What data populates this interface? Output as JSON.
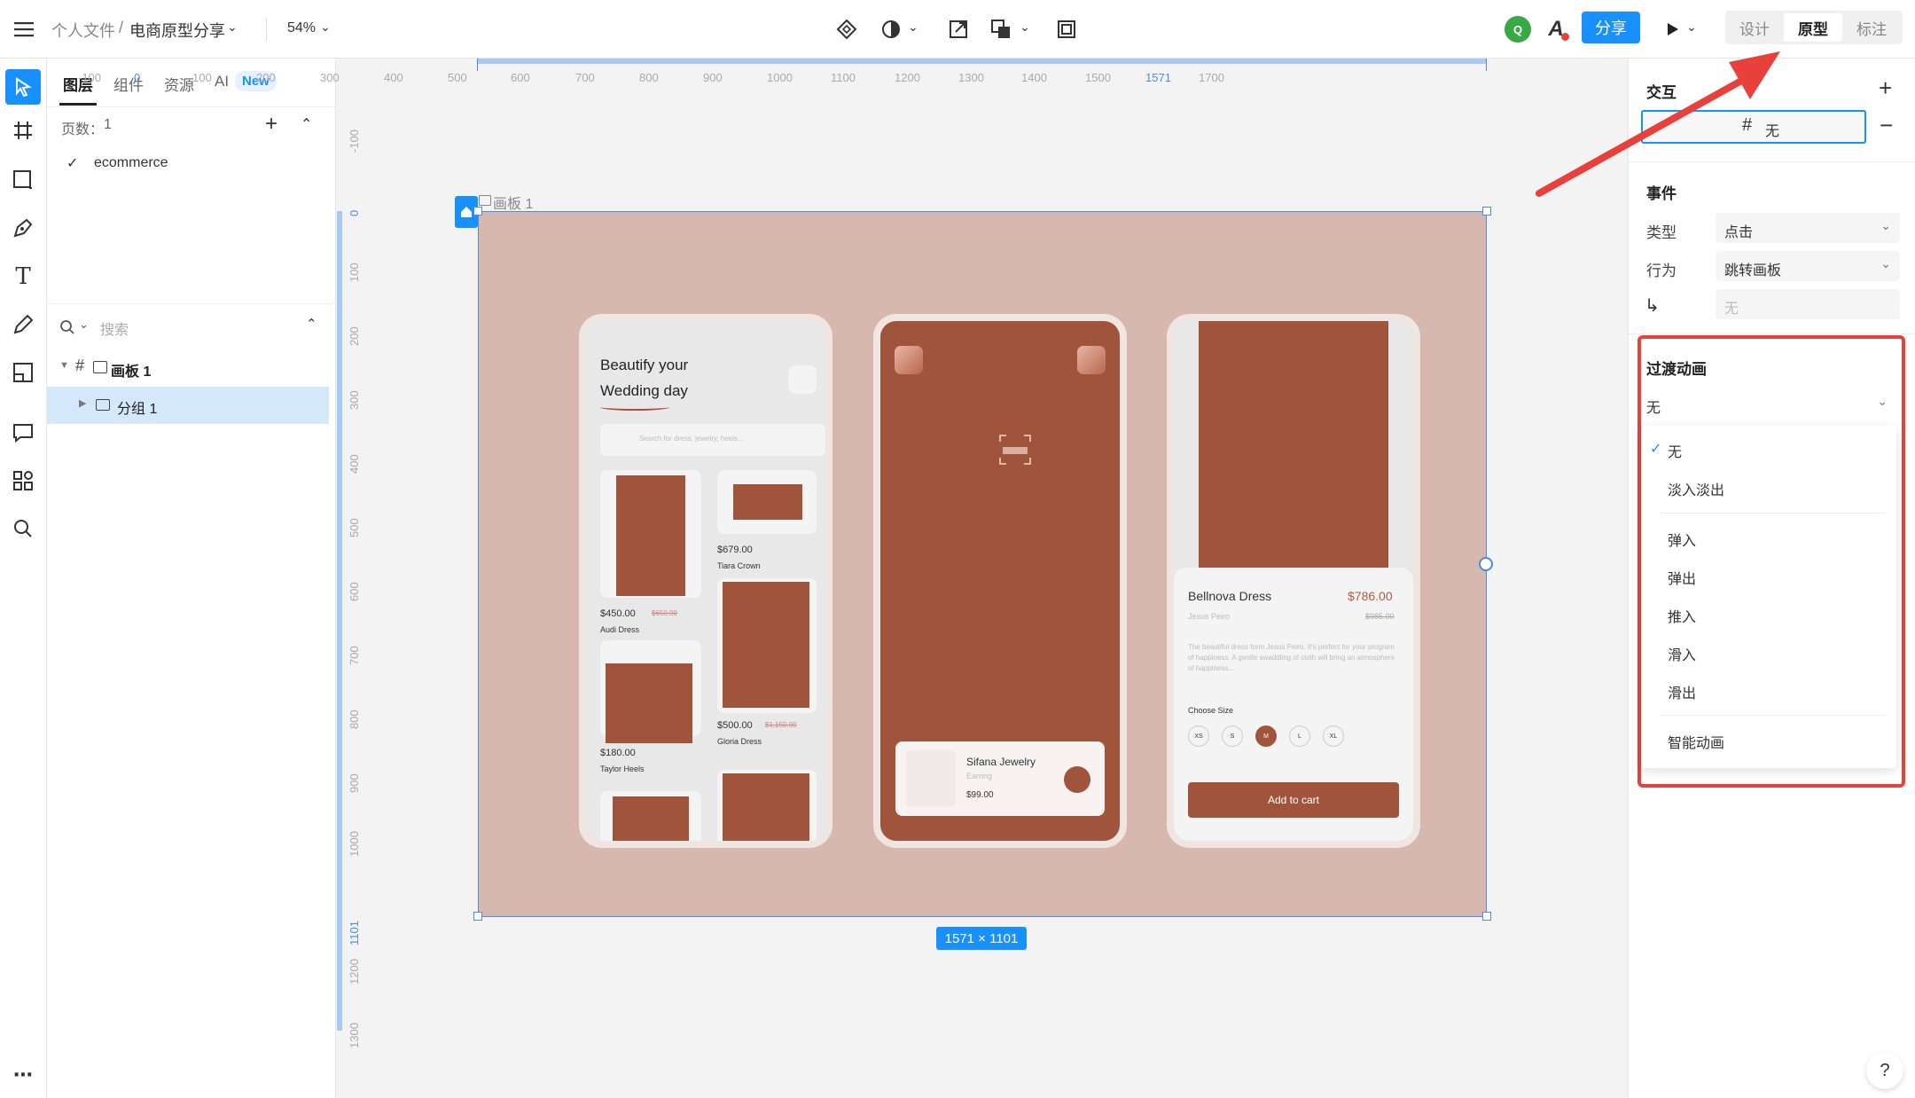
{
  "topbar": {
    "breadcrumb_parent": "个人文件",
    "breadcrumb_sep": "/",
    "file_name": "电商原型分享",
    "zoom": "54%",
    "avatar_letter": "Q",
    "share_label": "分享",
    "mode_tabs": [
      "设计",
      "原型",
      "标注"
    ],
    "active_mode": "原型"
  },
  "left_panel": {
    "tabs": [
      "图层",
      "组件",
      "资源",
      "AI"
    ],
    "ai_badge": "New",
    "pages_label": "页数：",
    "pages_count": "1",
    "pages": [
      "ecommerce"
    ],
    "search_placeholder": "搜索",
    "layers": [
      {
        "label": "画板 1",
        "level": 0
      },
      {
        "label": "分组 1",
        "level": 1
      }
    ]
  },
  "canvas": {
    "frame_label": "画板 1",
    "frame_size": "1571 × 1101",
    "h_ruler": [
      "-100",
      "0",
      "100",
      "200",
      "300",
      "400",
      "500",
      "600",
      "700",
      "800",
      "900",
      "1000",
      "1100",
      "1200",
      "1300",
      "1400",
      "1500",
      "1571",
      "1700"
    ],
    "v_ruler": [
      "-100",
      "0",
      "100",
      "200",
      "300",
      "400",
      "500",
      "600",
      "700",
      "800",
      "900",
      "1000",
      "1101",
      "1200",
      "1300"
    ],
    "screen1": {
      "title_line1": "Beautify your",
      "title_line2": "Wedding day",
      "search_placeholder": "Search for dress, jewelry, heels...",
      "products": [
        {
          "price": "$450.00",
          "old_price": "$650.00",
          "name": "Audi Dress"
        },
        {
          "price": "$679.00",
          "old_price": "",
          "name": "Tiara Crown"
        },
        {
          "price": "$180.00",
          "old_price": "",
          "name": "Taylor Heels"
        },
        {
          "price": "$500.00",
          "old_price": "$1,150.00",
          "name": "Gloria Dress"
        }
      ]
    },
    "screen2": {
      "card_title": "Sifana Jewelry",
      "card_sub": "Earring",
      "card_price": "$99.00"
    },
    "screen3": {
      "title": "Bellnova Dress",
      "price": "$786.00",
      "brand": "Jesus Peiro",
      "old_price": "$985.00",
      "description": "The beautiful dress form Jesus Peiro. It's perfect for your program of happiness. A gentle swaddling of cloth will bring an atmosphere of happiness...",
      "size_label": "Choose Size",
      "sizes": [
        "XS",
        "S",
        "M",
        "L",
        "XL"
      ],
      "selected_size": "M",
      "cta": "Add to cart"
    }
  },
  "right_panel": {
    "interaction_title": "交互",
    "trigger_target": "无",
    "event_title": "事件",
    "type_label": "类型",
    "type_value": "点击",
    "action_label": "行为",
    "action_value": "跳转画板",
    "target_value": "无",
    "transition_title": "过渡动画",
    "transition_value": "无",
    "transition_options": [
      "无",
      "淡入淡出",
      "弹入",
      "弹出",
      "推入",
      "滑入",
      "滑出",
      "智能动画"
    ],
    "selected_option": "无"
  },
  "colors": {
    "accent": "#1890ff",
    "frame_bg": "#d6b8ae",
    "product_brown": "#a0543c",
    "annotation_red": "#e8413c",
    "avatar_green": "#3aa845"
  }
}
